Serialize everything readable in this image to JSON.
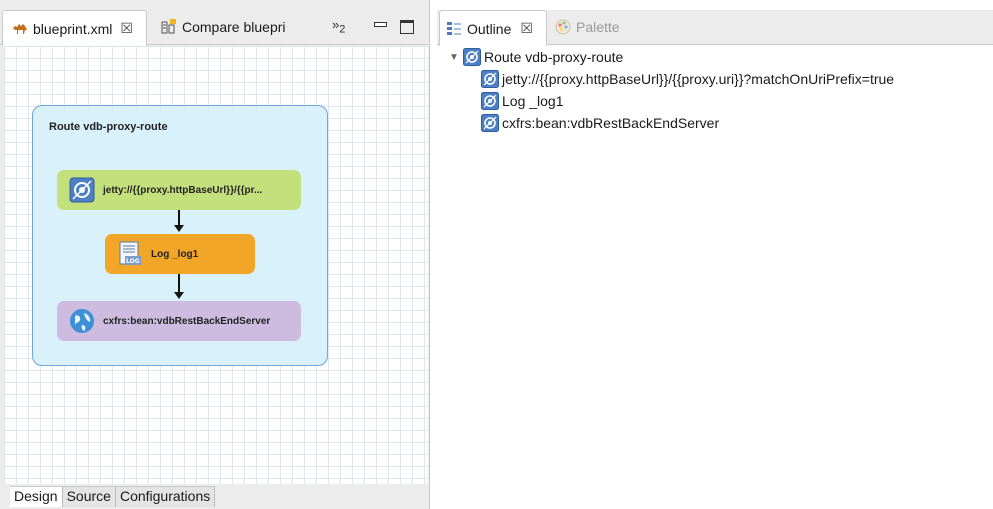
{
  "editor": {
    "tabs": [
      {
        "label": "blueprint.xml",
        "close": "☒",
        "active": true
      },
      {
        "label": "Compare bluepri",
        "active": false
      }
    ],
    "overflow": {
      "chevron": "»",
      "count": "2"
    },
    "bottom_tabs": [
      "Design",
      "Source",
      "Configurations"
    ],
    "route": {
      "title": "Route vdb-proxy-route",
      "nodes": [
        {
          "label": "jetty://{{proxy.httpBaseUrl}}/{{pr...",
          "icon": "endpoint-icon",
          "color": "#c4e07c"
        },
        {
          "label": "Log _log1",
          "icon": "log-icon",
          "color": "#f2a628"
        },
        {
          "label": "cxfrs:bean:vdbRestBackEndServer",
          "icon": "globe-icon",
          "color": "#cdbbe0"
        }
      ]
    }
  },
  "outline": {
    "tabs": [
      {
        "label": "Outline",
        "close": "☒",
        "active": true
      },
      {
        "label": "Palette",
        "active": false
      }
    ],
    "tree": {
      "root": "Route vdb-proxy-route",
      "children": [
        "jetty://{{proxy.httpBaseUrl}}/{{proxy.uri}}?matchOnUriPrefix=true",
        "Log _log1",
        "cxfrs:bean:vdbRestBackEndServer"
      ]
    }
  }
}
